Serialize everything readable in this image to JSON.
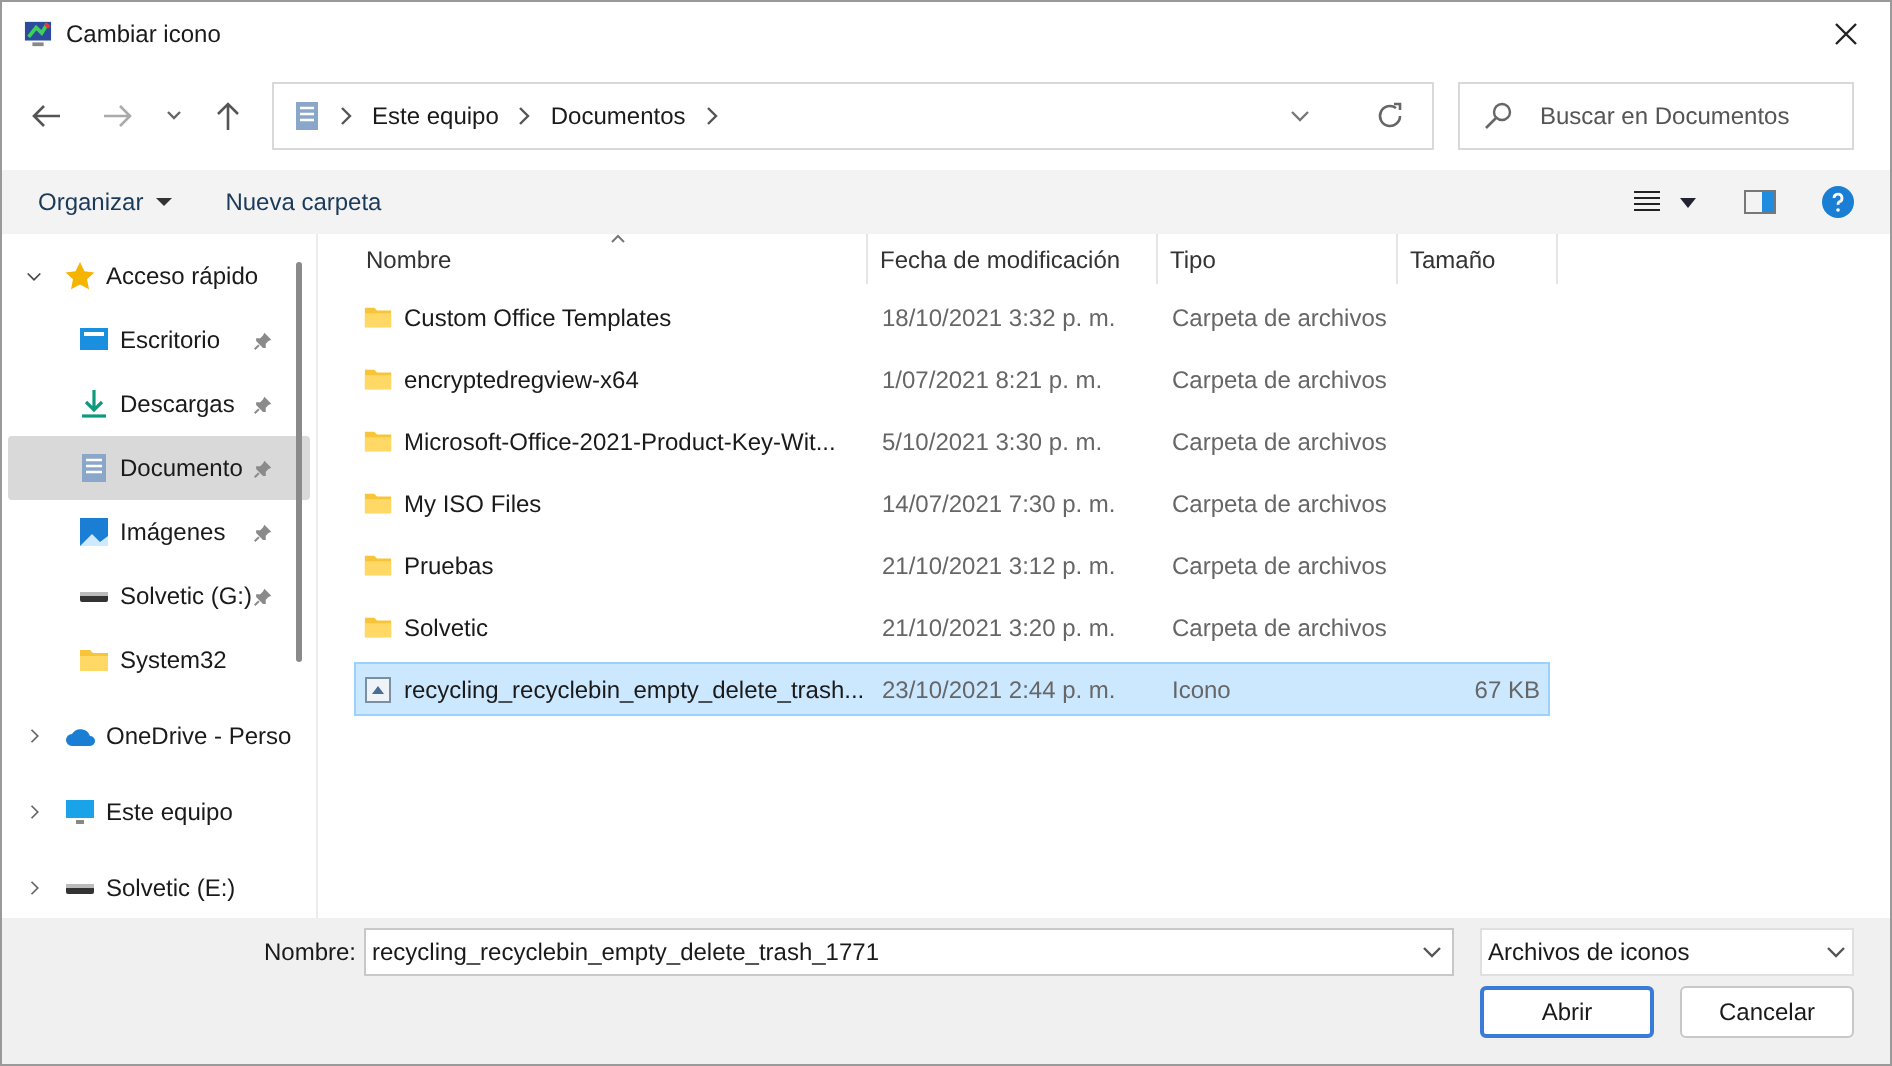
{
  "window": {
    "title": "Cambiar icono"
  },
  "address": {
    "segments": [
      "Este equipo",
      "Documentos"
    ]
  },
  "search": {
    "placeholder": "Buscar en Documentos"
  },
  "toolbar": {
    "organize": "Organizar",
    "new_folder": "Nueva carpeta"
  },
  "nav": [
    {
      "label": "Acceso rápido",
      "expanded": true,
      "selected": false,
      "children": [
        {
          "label": "Escritorio",
          "pinned": true,
          "selected": false
        },
        {
          "label": "Descargas",
          "pinned": true,
          "selected": false
        },
        {
          "label": "Documento",
          "pinned": true,
          "selected": true
        },
        {
          "label": "Imágenes",
          "pinned": true,
          "selected": false
        },
        {
          "label": "Solvetic (G:)",
          "pinned": true,
          "selected": false
        },
        {
          "label": "System32",
          "pinned": false,
          "selected": false
        }
      ]
    },
    {
      "label": "OneDrive - Perso",
      "expanded": false,
      "selected": false
    },
    {
      "label": "Este equipo",
      "expanded": false,
      "selected": false
    },
    {
      "label": "Solvetic (E:)",
      "expanded": false,
      "selected": false
    }
  ],
  "table": {
    "columns": [
      "Nombre",
      "Fecha de modificación",
      "Tipo",
      "Tamaño"
    ],
    "rows": [
      {
        "kind": "folder",
        "name": "Custom Office Templates",
        "date": "18/10/2021 3:32 p. m.",
        "type": "Carpeta de archivos",
        "selected": false
      },
      {
        "kind": "folder",
        "name": "encryptedregview-x64",
        "date": "1/07/2021 8:21 p. m.",
        "type": "Carpeta de archivos",
        "selected": false
      },
      {
        "kind": "folder",
        "name": "Microsoft-Office-2021-Product-Key-Wit...",
        "date": "5/10/2021 3:30 p. m.",
        "type": "Carpeta de archivos",
        "selected": false
      },
      {
        "kind": "folder",
        "name": "My ISO Files",
        "date": "14/07/2021 7:30 p. m.",
        "type": "Carpeta de archivos",
        "selected": false
      },
      {
        "kind": "folder",
        "name": "Pruebas",
        "date": "21/10/2021 3:12 p. m.",
        "type": "Carpeta de archivos",
        "selected": false
      },
      {
        "kind": "folder",
        "name": "Solvetic",
        "date": "21/10/2021 3:20 p. m.",
        "type": "Carpeta de archivos",
        "selected": false
      },
      {
        "kind": "file",
        "name": "recycling_recyclebin_empty_delete_trash...",
        "date": "23/10/2021 2:44 p. m.",
        "type": "Icono",
        "size": "67 KB",
        "selected": true
      }
    ]
  },
  "footer": {
    "name_label": "Nombre:",
    "name_value": "recycling_recyclebin_empty_delete_trash_1771",
    "filter": "Archivos de iconos",
    "buttons": [
      "Abrir",
      "Cancelar"
    ]
  }
}
